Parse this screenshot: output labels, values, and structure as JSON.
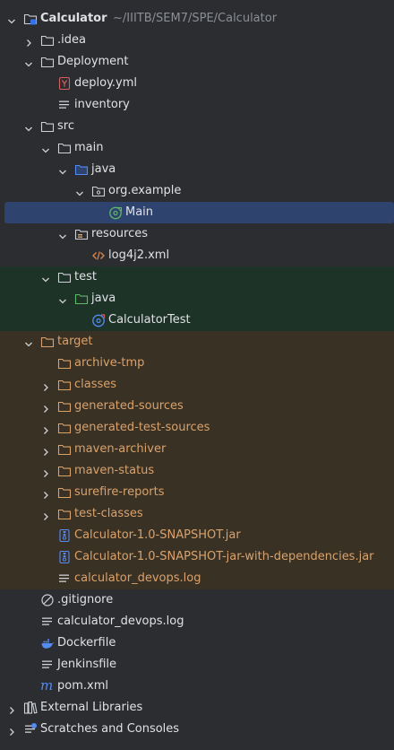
{
  "project_tree": {
    "colors": {
      "background": "#2b2d30",
      "text": "#dfe1e5",
      "excluded_text": "#d9a26a",
      "selected_bg": "#2e436e",
      "test_bg": "#1e3328",
      "excluded_bg": "#3a3125"
    },
    "rows": [
      {
        "label": "Calculator",
        "path": "~/IIITB/SEM7/SPE/Calculator",
        "icon": "project-folder-icon",
        "expanded": true,
        "bold": true
      },
      {
        "label": ".idea",
        "icon": "folder-icon",
        "expanded": false
      },
      {
        "label": "Deployment",
        "icon": "folder-icon",
        "expanded": true
      },
      {
        "label": "deploy.yml",
        "icon": "yaml-file-icon"
      },
      {
        "label": "inventory",
        "icon": "text-file-icon"
      },
      {
        "label": "src",
        "icon": "folder-icon",
        "expanded": true
      },
      {
        "label": "main",
        "icon": "folder-icon",
        "expanded": true
      },
      {
        "label": "java",
        "icon": "source-folder-icon",
        "expanded": true
      },
      {
        "label": "org.example",
        "icon": "package-icon",
        "expanded": true
      },
      {
        "label": "Main",
        "icon": "java-class-icon",
        "selected": true
      },
      {
        "label": "resources",
        "icon": "resources-folder-icon",
        "expanded": true
      },
      {
        "label": "log4j2.xml",
        "icon": "xml-file-icon"
      },
      {
        "label": "test",
        "icon": "folder-icon",
        "expanded": true
      },
      {
        "label": "java",
        "icon": "test-source-folder-icon",
        "expanded": true
      },
      {
        "label": "CalculatorTest",
        "icon": "java-test-class-icon"
      },
      {
        "label": "target",
        "icon": "excluded-folder-icon",
        "expanded": true
      },
      {
        "label": "archive-tmp",
        "icon": "excluded-folder-icon"
      },
      {
        "label": "classes",
        "icon": "excluded-folder-icon",
        "expanded": false
      },
      {
        "label": "generated-sources",
        "icon": "excluded-folder-icon",
        "expanded": false
      },
      {
        "label": "generated-test-sources",
        "icon": "excluded-folder-icon",
        "expanded": false
      },
      {
        "label": "maven-archiver",
        "icon": "excluded-folder-icon",
        "expanded": false
      },
      {
        "label": "maven-status",
        "icon": "excluded-folder-icon",
        "expanded": false
      },
      {
        "label": "surefire-reports",
        "icon": "excluded-folder-icon",
        "expanded": false
      },
      {
        "label": "test-classes",
        "icon": "excluded-folder-icon",
        "expanded": false
      },
      {
        "label": "Calculator-1.0-SNAPSHOT.jar",
        "icon": "jar-file-icon"
      },
      {
        "label": "Calculator-1.0-SNAPSHOT-jar-with-dependencies.jar",
        "icon": "jar-file-icon"
      },
      {
        "label": "calculator_devops.log",
        "icon": "text-file-icon"
      },
      {
        "label": ".gitignore",
        "icon": "ignore-file-icon"
      },
      {
        "label": "calculator_devops.log",
        "icon": "text-file-icon"
      },
      {
        "label": "Dockerfile",
        "icon": "docker-icon"
      },
      {
        "label": "Jenkinsfile",
        "icon": "text-file-icon"
      },
      {
        "label": "pom.xml",
        "icon": "maven-icon"
      },
      {
        "label": "External Libraries",
        "icon": "libraries-icon",
        "expanded": false
      },
      {
        "label": "Scratches and Consoles",
        "icon": "scratches-icon",
        "expanded": false
      }
    ]
  }
}
